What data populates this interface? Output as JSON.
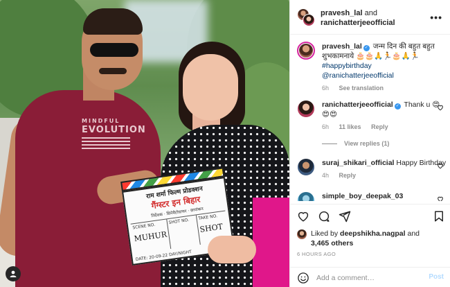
{
  "photo": {
    "shirt_text_small": "MINDFUL",
    "shirt_text_big": "EVOLUTION",
    "clapboard": {
      "line1": "राम शर्मा फिल्म प्रोडक्शन",
      "line2": "गैंग्स्टर इन बिहार",
      "line3": "निर्देशक · सिनेमैटोग्राफर · छायांकन",
      "cols": [
        "SCENE NO.",
        "SHOT NO.",
        "TAKE NO."
      ],
      "handwriting": [
        "MUHUR",
        "",
        "SHOT"
      ],
      "footer": "DATE: 20-09-22   DAY/NIGHT"
    },
    "user_tag_icon": "person-icon"
  },
  "header": {
    "user1": "pravesh_lal",
    "and_text": " and",
    "user2": "ranichatterjeeofficial",
    "more_icon": "more-horizontal-icon",
    "more_glyph": "•••"
  },
  "caption": {
    "username": "pravesh_lal",
    "text": " जन्म दिन की बहुत बहुत शुभकामनाये 🎂🎂🙏🏃🎂🙏🏃",
    "hashtag": "#happybirthday",
    "mention": "@ranichatterjeeofficial",
    "time": "6h",
    "see_translation": "See translation"
  },
  "comments": [
    {
      "username": "ranichatterjeeofficial",
      "verified": true,
      "text": " Thank u 😍😍😍",
      "time": "6h",
      "likes": "11 likes",
      "reply": "Reply",
      "view_replies": "View replies (1)"
    },
    {
      "username": "suraj_shikari_official",
      "verified": false,
      "text": " Happy Birthday",
      "time": "4h",
      "likes": "",
      "reply": "Reply"
    },
    {
      "username": "simple_boy_deepak_03",
      "verified": false,
      "text": "",
      "time": "",
      "likes": "",
      "reply": ""
    }
  ],
  "actions": {
    "like_icon": "heart-icon",
    "comment_icon": "comment-icon",
    "share_icon": "send-icon",
    "save_icon": "bookmark-icon"
  },
  "likes": {
    "prefix": "Liked by ",
    "user": "deepshikha.nagpal",
    "and_text": " and",
    "others": "3,465 others"
  },
  "timestamp": "6 HOURS AGO",
  "add_comment": {
    "emoji_icon": "smiley-icon",
    "placeholder": "Add a comment…",
    "post_label": "Post"
  },
  "colors": {
    "verified": "#3897f0",
    "link": "#00376b",
    "muted": "#8e8e8e",
    "post_disabled": "#b3dbff",
    "shirt": "#8a1d37",
    "saree_accent": "#e0178a"
  }
}
